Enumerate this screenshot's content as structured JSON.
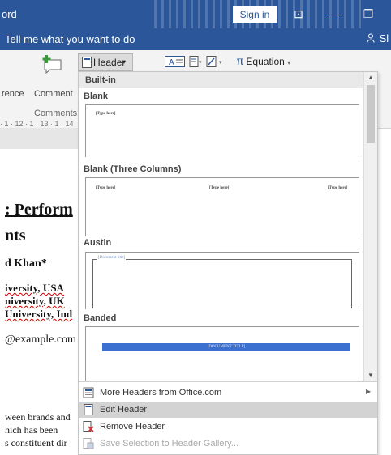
{
  "titlebar": {
    "app_fragment": "ord",
    "signin_label": "Sign in",
    "restore_glyph": "⊡",
    "minimize_glyph": "—",
    "maximize_glyph": "❐"
  },
  "tellbar": {
    "tell_me": "Tell me what you want to do",
    "share_fragment": "Sl"
  },
  "ribbon": {
    "rence_fragment": "rence",
    "comment_label": "Comment",
    "comments_group": "Comments",
    "header_button": "Header",
    "equation_label": "Equation",
    "ruler_text": "· 1 · 12 · 1 · 13 · 1 · 14"
  },
  "document": {
    "title_fragment": ": Perform",
    "title_fragment2": "nts",
    "author_fragment": "d Khan*",
    "affil1": "iversity, USA",
    "affil2": "niversity, UK",
    "affil3": "University, Ind",
    "email_fragment": "@example.com",
    "body1": "ween brands and",
    "body2": "hich  has  been",
    "body3": "s constituent dir"
  },
  "gallery": {
    "builtin": "Built-in",
    "categories": {
      "blank": "Blank",
      "three": "Blank (Three Columns)",
      "austin": "Austin",
      "banded": "Banded"
    },
    "type_here": "[Type here]",
    "document_title": "[Document title]",
    "banded_title": "[DOCUMENT TITLE]",
    "menu": {
      "more": "More Headers from Office.com",
      "edit": "Edit Header",
      "remove": "Remove Header",
      "save": "Save Selection to Header Gallery..."
    }
  },
  "colors": {
    "accent": "#2b579a",
    "banded_bar": "#3b6fd0",
    "highlight": "#d3d3d3"
  },
  "icons": [
    "comment-icon",
    "header-icon",
    "textbox-icon",
    "quickparts-icon",
    "signature-icon",
    "pi-icon",
    "office-icon",
    "edit-header-icon",
    "remove-header-icon",
    "save-selection-icon"
  ]
}
